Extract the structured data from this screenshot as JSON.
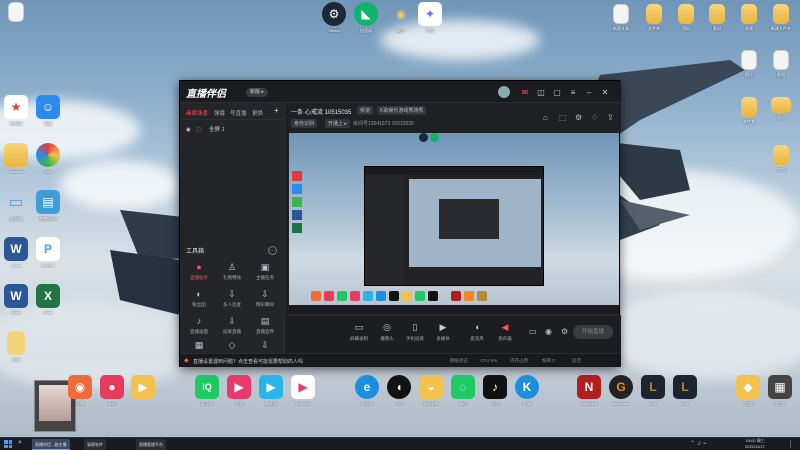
{
  "app": {
    "name": "直播伴侣",
    "version_badge": "新版 ▸",
    "left_tabs": [
      "画面场景",
      "弹幕",
      "号直播",
      "更换"
    ],
    "scene": "全屏 1",
    "room_title": "一条·心戒流 10515035",
    "room_tags": [
      "频道",
      "K歌娱乐游戏秀场秀",
      "身份识别",
      "开播上 ▸"
    ],
    "room_id": "房间号12641673  10515035",
    "tools_title": "工具箱",
    "tools": [
      {
        "label": "直播助手",
        "icon": "●",
        "accent": true
      },
      {
        "label": "礼物特效",
        "icon": "♙",
        "accent": false
      },
      {
        "label": "主播任务",
        "icon": "▣",
        "accent": false
      },
      {
        "label": "粉丝团",
        "icon": "◐",
        "accent": false
      },
      {
        "label": "多人连麦",
        "icon": "⇩",
        "accent": false
      },
      {
        "label": "精彩瞬间",
        "icon": "⇩",
        "accent": false
      },
      {
        "label": "直播画面",
        "icon": "♪",
        "accent": false
      },
      {
        "label": "投屏直播",
        "icon": "⇩",
        "accent": false
      },
      {
        "label": "直播宣传",
        "icon": "▤",
        "accent": false
      },
      {
        "label": "更多",
        "icon": "▦",
        "accent": false
      },
      {
        "label": "活动",
        "icon": "◇",
        "accent": false
      },
      {
        "label": "设置",
        "icon": "⇩",
        "accent": false
      }
    ],
    "bottom_controls": [
      {
        "label": "屏幕录制",
        "icon": "▭"
      },
      {
        "label": "摄像头",
        "icon": "◎"
      },
      {
        "label": "手机投屏",
        "icon": "▯"
      },
      {
        "label": "多媒体",
        "icon": "▶"
      },
      {
        "label": "麦克风",
        "icon": "◖"
      },
      {
        "label": "扬声器",
        "icon": "◀"
      }
    ],
    "go_live_label": "开始直播",
    "status_warning": "直播设置遇到问题？点击查看可能需要帮助的人吗",
    "status_right": [
      "网络状态",
      "CPU 6%",
      "内存占用",
      "帧率:0",
      "延迟"
    ],
    "accent_color": "#ff4d59"
  },
  "desktop": {
    "top_icons": [
      {
        "label": "Steam",
        "icon": "S",
        "color": "#1b2838"
      },
      {
        "label": "加速器",
        "icon": "◣",
        "color": "#10b36b"
      },
      {
        "label": "助手",
        "icon": "◉",
        "color": "#f0c36a"
      },
      {
        "label": "应用",
        "icon": "✦",
        "color": "#6b6df0"
      }
    ],
    "left_icons": [
      {
        "label": "快剪辑",
        "icon": "★",
        "color": "#e33b3b"
      },
      {
        "label": "迅雷",
        "icon": "☺",
        "color": "#2d8bf0"
      },
      {
        "label": "Desktop",
        "icon": "▦",
        "color": "#f2b23b"
      },
      {
        "label": "360",
        "icon": "◍",
        "color": "#3bb54a"
      },
      {
        "label": "此电脑",
        "icon": "▭",
        "color": "#5aa0e0"
      },
      {
        "label": "控制面板",
        "icon": "▤",
        "color": "#3f9dd6"
      },
      {
        "label": "Word",
        "icon": "W",
        "color": "#2b5797"
      },
      {
        "label": "PicPick",
        "icon": "P",
        "color": "#2db0d8"
      },
      {
        "label": "Word",
        "icon": "W",
        "color": "#2b5797"
      },
      {
        "label": "Excel",
        "icon": "X",
        "color": "#217346"
      },
      {
        "label": "文档",
        "icon": "▢",
        "color": "#f2d37a"
      }
    ],
    "right_icons": [
      {
        "label": "新建文本",
        "icon": "▢",
        "color": "#f4f4f4"
      },
      {
        "label": "文件夹",
        "icon": "▭",
        "color": "#f2c14e"
      },
      {
        "label": "资料",
        "icon": "▭",
        "color": "#f2c14e"
      },
      {
        "label": "素材",
        "icon": "▭",
        "color": "#f2c14e"
      },
      {
        "label": "视频",
        "icon": "▭",
        "color": "#f2c14e"
      },
      {
        "label": "新建文件夹",
        "icon": "▭",
        "color": "#f2c14e"
      },
      {
        "label": "图片",
        "icon": "▢",
        "color": "#f4f4f4"
      },
      {
        "label": "截图",
        "icon": "▢",
        "color": "#f4f4f4"
      },
      {
        "label": "文件夹",
        "icon": "▭",
        "color": "#f2c14e"
      },
      {
        "label": "相册",
        "icon": "▭",
        "color": "#f2c14e"
      },
      {
        "label": "文档",
        "icon": "▭",
        "color": "#f2c14e"
      }
    ],
    "dock_icons": [
      {
        "label": "直播",
        "icon": "◉",
        "color": "#f06a3b"
      },
      {
        "label": "录屏",
        "icon": "●",
        "color": "#e63b5a"
      },
      {
        "label": "爱奇艺",
        "icon": "iQ",
        "color": "#1ec862"
      },
      {
        "label": "视频",
        "icon": "▶",
        "color": "#e83b6a"
      },
      {
        "label": "播放器",
        "icon": "▶",
        "color": "#29b5ea"
      },
      {
        "label": "YOUKU",
        "icon": "▶",
        "color": "#e8396b"
      },
      {
        "label": "浏览器",
        "icon": "e",
        "color": "#1a8fe0"
      },
      {
        "label": "QQ",
        "icon": "◖",
        "color": "#121212"
      },
      {
        "label": "QQ飞车",
        "icon": "◒",
        "color": "#f2c14e"
      },
      {
        "label": "微信",
        "icon": "◌",
        "color": "#1ec862"
      },
      {
        "label": "抖音",
        "icon": "♪",
        "color": "#111111"
      },
      {
        "label": "酷狗",
        "icon": "K",
        "color": "#1a8fe0"
      },
      {
        "label": "NARAKA",
        "icon": "N",
        "color": "#b21e1e"
      },
      {
        "label": "WeGame",
        "icon": "G",
        "color": "#f08a1e"
      },
      {
        "label": "LOL",
        "icon": "L",
        "color": "#b58a3b"
      },
      {
        "label": "LOL",
        "icon": "L",
        "color": "#b58a3b"
      },
      {
        "label": "游戏",
        "icon": "◆",
        "color": "#f2c14e"
      },
      {
        "label": "应用",
        "icon": "▦",
        "color": "#444444"
      }
    ]
  },
  "taskbar": {
    "items": [
      "直播伴侣 - 副主播",
      "录屏软件",
      "直播管理平台"
    ],
    "clock_time": "15:02 周三",
    "clock_date": "2022/11/17"
  }
}
